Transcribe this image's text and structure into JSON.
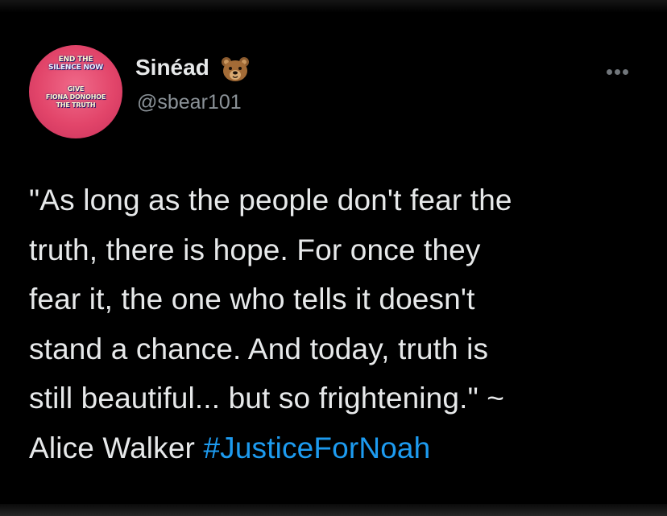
{
  "tweet": {
    "avatar": {
      "lines": [
        "END THE",
        "SILENCE NOW",
        "GIVE",
        "FIONA DONOHOE",
        "THE TRUTH"
      ]
    },
    "display_name": "Sinéad",
    "name_emoji": "bear-face-icon",
    "handle": "@sbear101",
    "more_icon": "more-horizontal-icon",
    "text_lines": [
      "\"As long as the people don't fear the",
      "truth, there is hope. For once they",
      "fear it, the one who tells it doesn't",
      "stand a chance. And today, truth is",
      "still beautiful... but so frightening.\" ~"
    ],
    "last_line_prefix": "Alice Walker ",
    "hashtag": "#JusticeForNoah"
  },
  "colors": {
    "background": "#000000",
    "text": "#e7e9ea",
    "secondary": "#8b9298",
    "link": "#1d9bf0",
    "avatar": "#e2456a"
  }
}
